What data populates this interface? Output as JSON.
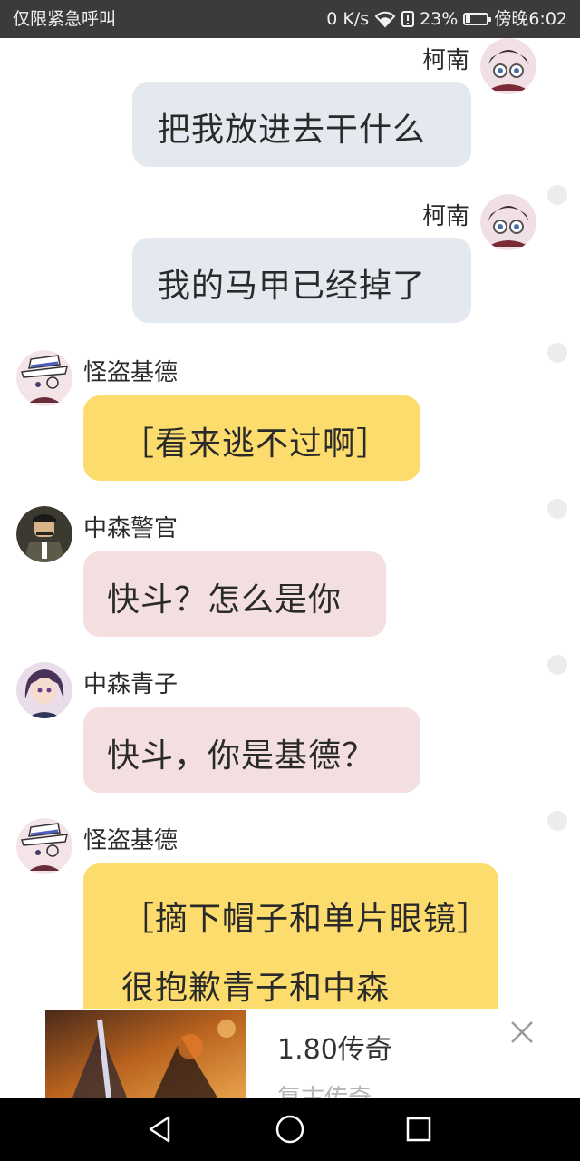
{
  "status_bar": {
    "left_text": "仅限紧急呼叫",
    "speed": "0 K/s",
    "battery_percent": "23%",
    "battery_level": 0.23,
    "time": "傍晚6:02"
  },
  "messages": [
    {
      "sender": "柯南",
      "text": "把我放进去干什么",
      "side": "right",
      "color": "blue",
      "avatar_icon": "conan-avatar-icon"
    },
    {
      "sender": "柯南",
      "text": "我的马甲已经掉了",
      "side": "right",
      "color": "blue",
      "avatar_icon": "conan-avatar-icon"
    },
    {
      "sender": "怪盗基德",
      "text": "［看来逃不过啊］",
      "side": "left",
      "color": "yellow",
      "avatar_icon": "kid-avatar-icon"
    },
    {
      "sender": "中森警官",
      "text": "快斗？怎么是你",
      "side": "left",
      "color": "pink",
      "avatar_icon": "nakamori-avatar-icon"
    },
    {
      "sender": "中森青子",
      "text": "快斗，你是基德？",
      "side": "left",
      "color": "pink",
      "avatar_icon": "aoko-avatar-icon"
    },
    {
      "sender": "怪盗基德",
      "text": "［摘下帽子和单片眼镜］很抱歉青子和中森",
      "side": "left",
      "color": "yellow",
      "avatar_icon": "kid-avatar-icon"
    }
  ],
  "ad": {
    "title": "1.80传奇",
    "subtitle": "复古传奇",
    "close_icon": "close-icon",
    "image_icon": "game-banner-image"
  },
  "nav_bar": {
    "back_icon": "back-triangle-icon",
    "home_icon": "home-circle-icon",
    "recents_icon": "recents-square-icon"
  },
  "colors": {
    "status_bar_bg": "#3b3b3b",
    "bubble_blue": "#e4e9f0",
    "bubble_yellow": "#fcdc6c",
    "bubble_pink": "#f4dfe0",
    "nav_bar_bg": "#000000"
  }
}
